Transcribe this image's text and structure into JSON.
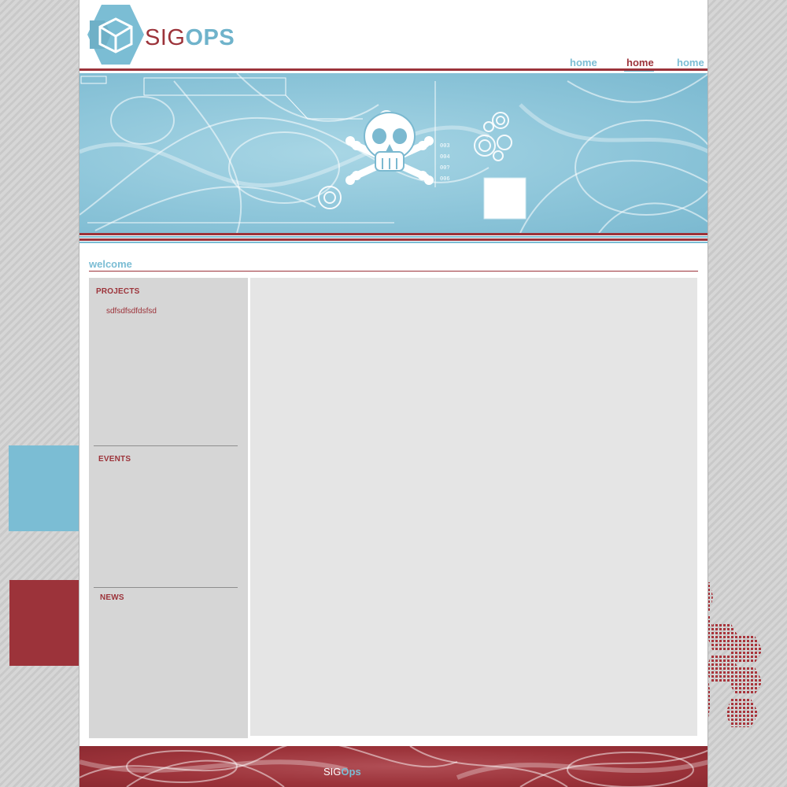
{
  "brand": {
    "logo_sig": "SIG",
    "logo_ops": "OPS"
  },
  "nav": {
    "items": [
      "home",
      "home",
      "home"
    ],
    "active_index": 1
  },
  "main": {
    "welcome_title": "welcome"
  },
  "sidebar": {
    "projects": {
      "heading": "PROJECTS",
      "items": [
        "sdfsdfsdfdsfsd"
      ]
    },
    "events": {
      "heading": "EVENTS"
    },
    "news": {
      "heading": "NEWS"
    }
  },
  "footer": {
    "brand_sig": "SIG",
    "brand_ops": "Ops"
  },
  "banner": {
    "readout_codes": [
      "003",
      "004",
      "00?",
      "006"
    ]
  },
  "colors": {
    "accent_red": "#9c333a",
    "accent_blue": "#7bbdd4",
    "sidebar_bg": "#d6d6d6",
    "content_bg": "#e5e5e5"
  },
  "icons": {
    "logo": "hexagon-cube-icon",
    "banner": "skull-crossbones-icon"
  }
}
